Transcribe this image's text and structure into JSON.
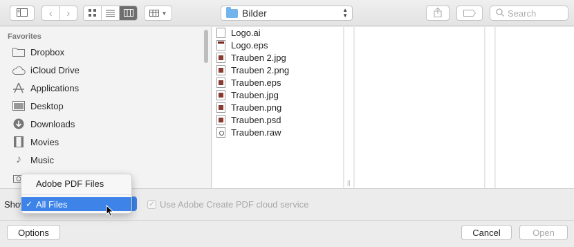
{
  "toolbar": {
    "path_folder": "Bilder",
    "search_placeholder": "Search"
  },
  "sidebar": {
    "heading": "Favorites",
    "items": [
      {
        "label": "Dropbox",
        "icon": "folder-icon"
      },
      {
        "label": "iCloud Drive",
        "icon": "cloud-icon"
      },
      {
        "label": "Applications",
        "icon": "applications-icon"
      },
      {
        "label": "Desktop",
        "icon": "desktop-icon"
      },
      {
        "label": "Downloads",
        "icon": "download-icon"
      },
      {
        "label": "Movies",
        "icon": "film-icon"
      },
      {
        "label": "Music",
        "icon": "music-icon"
      }
    ]
  },
  "files": [
    {
      "name": "Logo.ai",
      "type": "doc"
    },
    {
      "name": "Logo.eps",
      "type": "eps"
    },
    {
      "name": "Trauben 2.jpg",
      "type": "img"
    },
    {
      "name": "Trauben 2.png",
      "type": "img"
    },
    {
      "name": "Trauben.eps",
      "type": "img"
    },
    {
      "name": "Trauben.jpg",
      "type": "img"
    },
    {
      "name": "Trauben.png",
      "type": "img"
    },
    {
      "name": "Trauben.psd",
      "type": "img"
    },
    {
      "name": "Trauben.raw",
      "type": "raw"
    }
  ],
  "bottom": {
    "show_label": "Show",
    "checkbox_label": "Use Adobe Create PDF cloud service",
    "options_button": "Options",
    "cancel_button": "Cancel",
    "open_button": "Open"
  },
  "dropdown": {
    "items": [
      "Adobe PDF Files",
      "All Files"
    ],
    "selected_index": 1
  },
  "colors": {
    "accent": "#3d83e8",
    "folder": "#74b4ec"
  }
}
